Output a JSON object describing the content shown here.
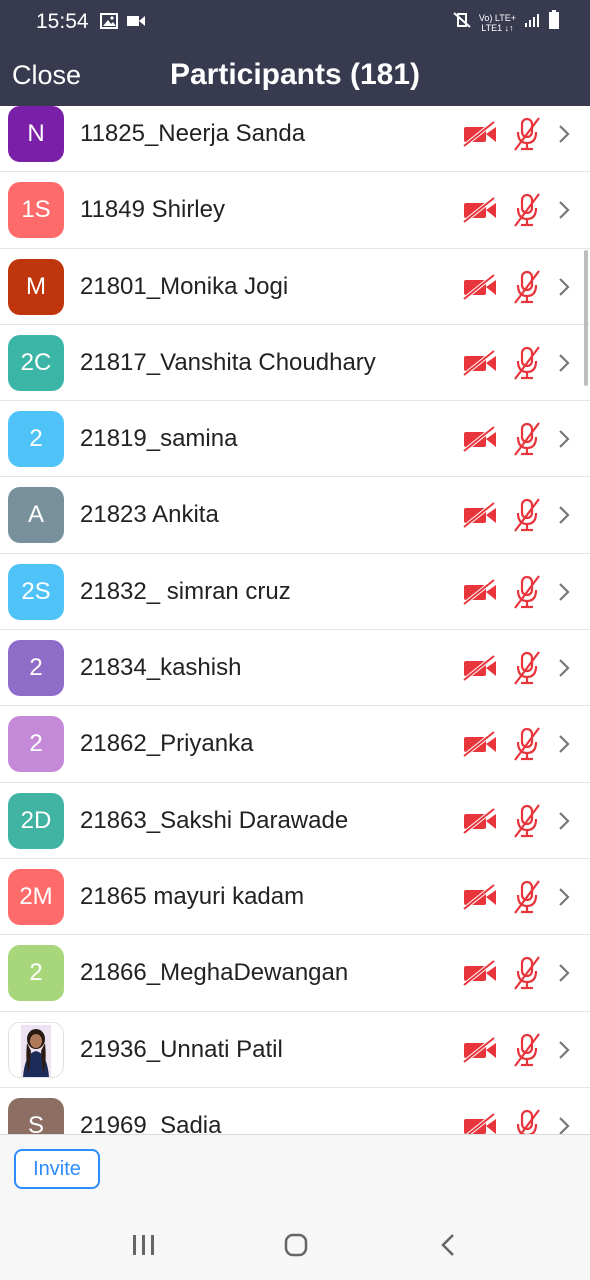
{
  "status_bar": {
    "time": "15:54",
    "network_top": "Vo) LTE+",
    "network_bottom": "LTE1 ↓↑"
  },
  "header": {
    "close_label": "Close",
    "title": "Participants (181)"
  },
  "colors": {
    "header_bg": "#383a4f",
    "muted_red": "#e8343b",
    "accent_blue": "#2d8cff"
  },
  "participants": [
    {
      "initials": "N",
      "name": "11825_Neerja Sanda",
      "avatar_color": "#7a1fa8"
    },
    {
      "initials": "1S",
      "name": "11849 Shirley",
      "avatar_color": "#ff6b6b"
    },
    {
      "initials": "M",
      "name": "21801_Monika Jogi",
      "avatar_color": "#c0360c"
    },
    {
      "initials": "2C",
      "name": "21817_Vanshita Choudhary",
      "avatar_color": "#3bb5a6"
    },
    {
      "initials": "2",
      "name": "21819_samina",
      "avatar_color": "#4fc3f7"
    },
    {
      "initials": "A",
      "name": "21823 Ankita",
      "avatar_color": "#78909c"
    },
    {
      "initials": "2S",
      "name": "21832_ simran cruz",
      "avatar_color": "#4fc3f7"
    },
    {
      "initials": "2",
      "name": "21834_kashish",
      "avatar_color": "#8e6cc7"
    },
    {
      "initials": "2",
      "name": "21862_Priyanka",
      "avatar_color": "#c48ad8"
    },
    {
      "initials": "2D",
      "name": "21863_Sakshi Darawade",
      "avatar_color": "#40b3a2"
    },
    {
      "initials": "2M",
      "name": "21865 mayuri kadam",
      "avatar_color": "#ff6b6b"
    },
    {
      "initials": "2",
      "name": "21866_MeghaDewangan",
      "avatar_color": "#a8d67a"
    },
    {
      "initials": "",
      "name": "21936_Unnati Patil",
      "avatar_color": "#ffffff",
      "photo": true
    },
    {
      "initials": "S",
      "name": "21969_Sadia",
      "avatar_color": "#8d6e63"
    }
  ],
  "footer": {
    "invite_label": "Invite"
  }
}
